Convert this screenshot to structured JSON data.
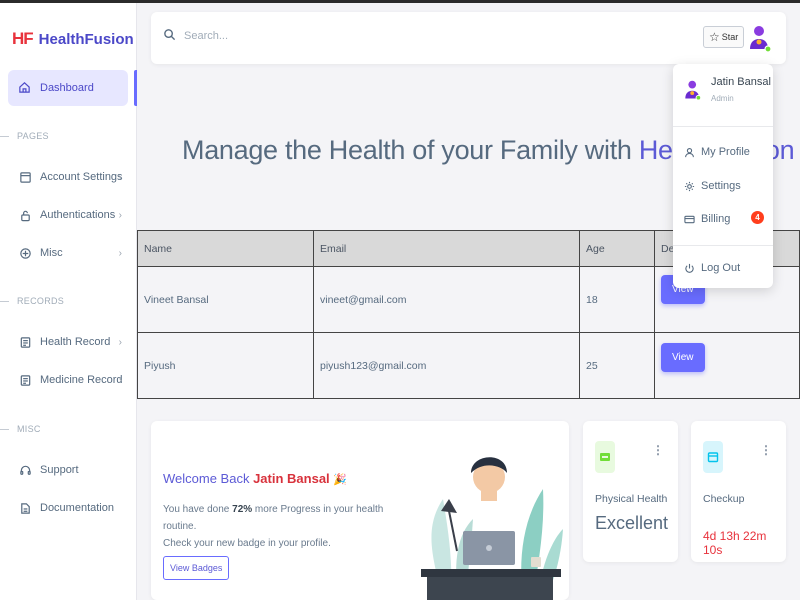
{
  "app": {
    "logo": "HF",
    "name": "HealthFusion"
  },
  "sidebar": {
    "active": {
      "label": "Dashboard",
      "icon": "home-icon"
    },
    "sections": {
      "pages": "PAGES",
      "records": "RECORDS",
      "misc": "MISC"
    },
    "items": {
      "account_settings": "Account Settings",
      "authentications": "Authentications",
      "misc": "Misc",
      "health_record": "Health Record",
      "medicine_record": "Medicine Record",
      "support": "Support",
      "documentation": "Documentation"
    }
  },
  "navbar": {
    "search_placeholder": "Search...",
    "star_label": "Star"
  },
  "user_menu": {
    "name": "Jatin Bansal",
    "role": "Admin",
    "items": {
      "profile": "My Profile",
      "settings": "Settings",
      "billing": "Billing",
      "logout": "Log Out"
    },
    "billing_badge": "4"
  },
  "hero": {
    "text": "Manage the Health of your Family with ",
    "brand": "HealthFusion"
  },
  "table": {
    "headers": {
      "name": "Name",
      "email": "Email",
      "age": "Age",
      "details": "Details"
    },
    "rows": [
      {
        "name": "Vineet Bansal",
        "email": "vineet@gmail.com",
        "age": "18",
        "action": "View"
      },
      {
        "name": "Piyush",
        "email": "piyush123@gmail.com",
        "age": "25",
        "action": "View"
      }
    ]
  },
  "welcome": {
    "prefix": "Welcome Back ",
    "user": "Jatin Bansal",
    "emoji": "🎉",
    "line1_pre": "You have done ",
    "line1_pct": "72%",
    "line1_post": " more Progress in your health routine.",
    "line2": "Check your new badge in your profile.",
    "button": "View Badges"
  },
  "stats": [
    {
      "label": "Physical Health",
      "value": "Excellent",
      "icon": "wallet-icon",
      "color": "#71dd37"
    },
    {
      "label": "Checkup",
      "value": "4d 13h 22m 10s",
      "icon": "calendar-icon",
      "color": "#03c3ec"
    }
  ],
  "colors": {
    "primary": "#696cff",
    "danger": "#e8323c",
    "success": "#71dd37",
    "info": "#03c3ec"
  }
}
